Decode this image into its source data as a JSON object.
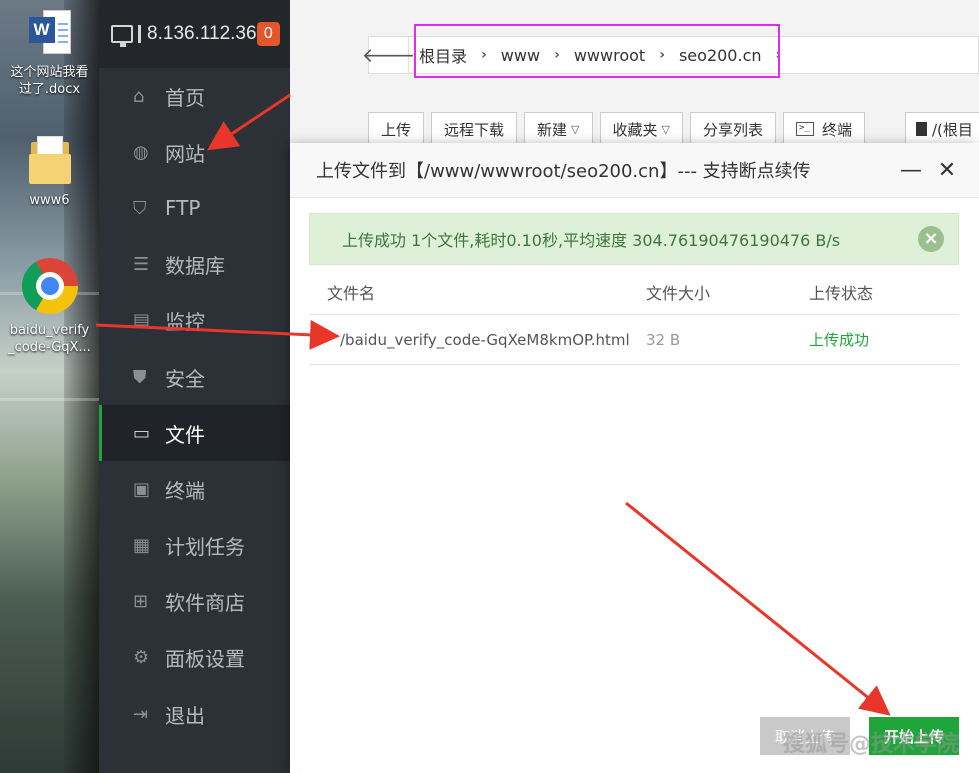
{
  "desktop": {
    "icons": [
      {
        "label_line1": "这个网站我看",
        "label_line2": "过了.docx",
        "badge": "W"
      },
      {
        "label_line1": "www6"
      },
      {
        "label_line1": "baidu_verify",
        "label_line2": "_code-GqX..."
      }
    ]
  },
  "sidebar": {
    "server_ip": "8.136.112.36",
    "badge_count": "0",
    "items": [
      {
        "label": "首页",
        "icon": "home-icon"
      },
      {
        "label": "网站",
        "icon": "globe-icon"
      },
      {
        "label": "FTP",
        "icon": "ftp-icon"
      },
      {
        "label": "数据库",
        "icon": "database-icon"
      },
      {
        "label": "监控",
        "icon": "monitor-chart-icon"
      },
      {
        "label": "安全",
        "icon": "shield-icon"
      },
      {
        "label": "文件",
        "icon": "folder-icon"
      },
      {
        "label": "终端",
        "icon": "terminal-icon"
      },
      {
        "label": "计划任务",
        "icon": "calendar-icon"
      },
      {
        "label": "软件商店",
        "icon": "grid-icon"
      },
      {
        "label": "面板设置",
        "icon": "gear-icon"
      },
      {
        "label": "退出",
        "icon": "logout-icon"
      }
    ],
    "active_item": "文件"
  },
  "file_manager": {
    "breadcrumb": [
      "根目录",
      "www",
      "wwwroot",
      "seo200.cn"
    ],
    "toolbar": {
      "upload": "上传",
      "remote_download": "远程下载",
      "new": "新建",
      "favorites": "收藏夹",
      "share_list": "分享列表",
      "terminal": "终端",
      "drive": "/(根目"
    }
  },
  "dialog": {
    "title": "上传文件到【/www/wwwroot/seo200.cn】--- 支持断点续传",
    "minimize": "—",
    "close": "✕",
    "alert": "上传成功 1个文件,耗时0.10秒,平均速度 304.76190476190476 B/s",
    "columns": {
      "name": "文件名",
      "size": "文件大小",
      "status": "上传状态"
    },
    "files": [
      {
        "name": "/baidu_verify_code-GqXeM8kmOP.html",
        "size": "32 B",
        "status": "上传成功"
      }
    ],
    "cancel_button": "取消上传",
    "start_button": "开始上传",
    "watermark": "搜狐号@技术学院"
  },
  "colors": {
    "accent": "#20a53a",
    "sidebar_bg": "#2c3138",
    "annotation_arrow": "#e8362a",
    "highlight_box": "#e02ee8"
  }
}
